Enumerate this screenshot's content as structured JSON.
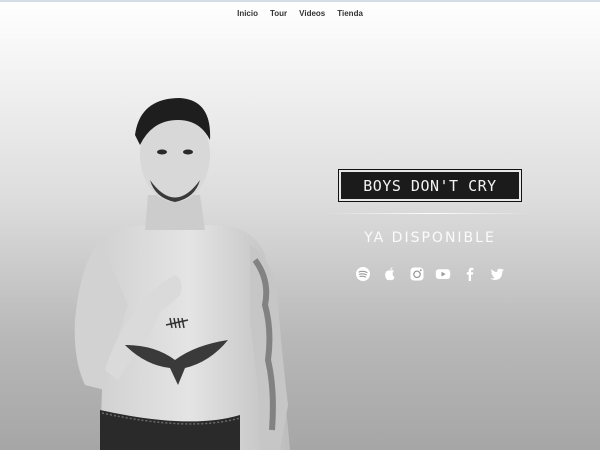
{
  "nav": {
    "items": [
      {
        "label": "Inicio"
      },
      {
        "label": "Tour"
      },
      {
        "label": "Videos"
      },
      {
        "label": "Tienda"
      }
    ]
  },
  "hero": {
    "album_title": "BOYS DON'T CRY",
    "subtitle": "YA DISPONIBLE"
  },
  "socials": {
    "icons": [
      "spotify-icon",
      "apple-icon",
      "instagram-icon",
      "youtube-icon",
      "facebook-icon",
      "twitter-icon"
    ]
  },
  "colors": {
    "album_box_bg": "#1b1b1b",
    "text_light": "#f2f2f2",
    "nav_text": "#333333"
  }
}
